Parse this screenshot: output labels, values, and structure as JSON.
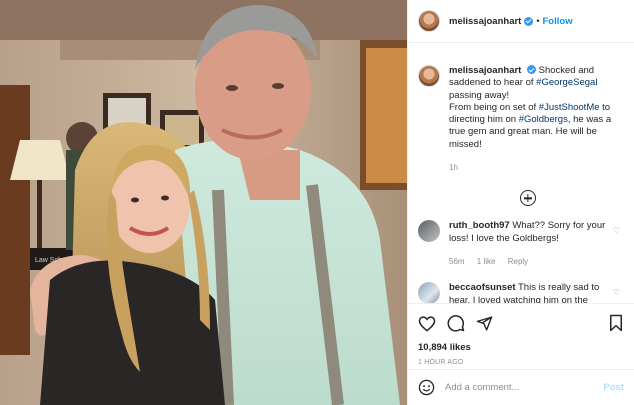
{
  "post": {
    "username": "melissajoanhart",
    "follow_label": "Follow",
    "separator": "•"
  },
  "caption": {
    "username": "melissajoanhart",
    "text_1": "Shocked and saddened to hear of ",
    "tag_1": "#GeorgeSegal",
    "text_2": " passing away!",
    "text_3": "From being on set of ",
    "tag_2": "#JustShootMe",
    "text_4": " to directing him on ",
    "tag_3": "#Goldbergs",
    "text_5": ", he was a true gem and great man. He will be missed!",
    "time": "1h"
  },
  "comments": [
    {
      "username": "ruth_booth97",
      "text": "What?? Sorry for your loss! I love the Goldbergs!",
      "time": "56m",
      "likes": "1 like",
      "reply": "Reply"
    },
    {
      "username": "beccaofsunset",
      "text": "This is really sad to hear. I loved watching him on the"
    }
  ],
  "actions": {
    "likes": "10,894 likes",
    "timestamp": "1 HOUR AGO"
  },
  "add_comment": {
    "placeholder": "Add a comment...",
    "post_label": "Post"
  },
  "photo": {
    "sign_text": "Law Sch"
  },
  "icons": [
    "heart-icon",
    "comment-icon",
    "share-icon",
    "bookmark-icon",
    "emoji-icon",
    "verified-icon",
    "add-comments-icon"
  ],
  "colors": {
    "accent": "#0095f6",
    "verified": "#3897f0",
    "muted": "#8e8e8e",
    "hashtag": "#00376b"
  }
}
